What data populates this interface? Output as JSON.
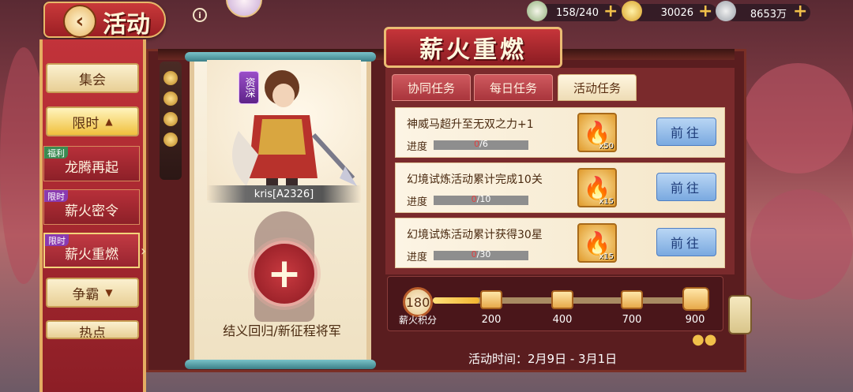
{
  "header": {
    "title": "活动",
    "back_label": "‹",
    "info_label": "i"
  },
  "resources": [
    {
      "name": "stamina",
      "value": "158/240"
    },
    {
      "name": "gold",
      "value": "30026"
    },
    {
      "name": "silver",
      "value": "8653万"
    }
  ],
  "nav": {
    "items": [
      {
        "label": "集会"
      },
      {
        "label": "限时",
        "expanded": true
      },
      {
        "label": "争霸"
      },
      {
        "label": "热点"
      }
    ],
    "sub_items": [
      {
        "tag": "福利",
        "label": "龙腾再起"
      },
      {
        "tag": "限时",
        "label": "薪火密令"
      },
      {
        "tag": "限时",
        "label": "薪火重燃",
        "selected": true
      }
    ]
  },
  "hero": {
    "rank": "资深",
    "name": "kris[A2326]",
    "recruit_text": "结义回归/新征程将军"
  },
  "event": {
    "title": "薪火重燃",
    "tabs": [
      {
        "label": "协同任务",
        "active": false
      },
      {
        "label": "每日任务",
        "active": false
      },
      {
        "label": "活动任务",
        "active": true
      }
    ],
    "tasks": [
      {
        "title": "神威马超升至无双之力+1",
        "progress_label": "进度",
        "current": "0",
        "total": "/6",
        "reward_count": "x50",
        "go_label": "前往"
      },
      {
        "title": "幻境试炼活动累计完成10关",
        "progress_label": "进度",
        "current": "0",
        "total": "/10",
        "reward_count": "x15",
        "go_label": "前往"
      },
      {
        "title": "幻境试炼活动累计获得30星",
        "progress_label": "进度",
        "current": "0",
        "total": "/30",
        "reward_count": "x15",
        "go_label": "前往"
      }
    ],
    "score": {
      "value": "180",
      "label": "薪火积分",
      "milestones": [
        "200",
        "400",
        "700",
        "900"
      ],
      "progress_fraction": 0.18
    },
    "activity_time": "活动时间：2月9日 - 3月1日"
  },
  "colors": {
    "accent_red": "#c6353a",
    "gold": "#f1c04a",
    "go_button_blue": "#7aa9e0"
  }
}
